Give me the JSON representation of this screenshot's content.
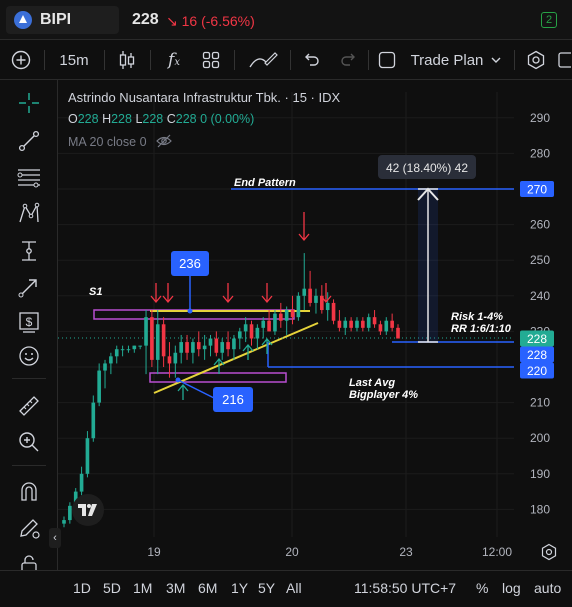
{
  "header": {
    "symbol": "BIPI",
    "price": "228",
    "change": "16 (-6.56%)",
    "alerts_badge": "2"
  },
  "toolbar": {
    "interval": "15m",
    "trade_plan_label": "Trade Plan"
  },
  "legend": {
    "title": "Astrindo Nusantara Infrastruktur Tbk. · 15 · IDX",
    "ohlc": [
      {
        "key": "O",
        "value": "228"
      },
      {
        "key": "H",
        "value": "228"
      },
      {
        "key": "L",
        "value": "228"
      },
      {
        "key": "C",
        "value": "228"
      },
      {
        "key": "",
        "value": "0 (0.00%)"
      }
    ],
    "ma_label": "MA 20 close 0"
  },
  "bottom": {
    "timeframes": [
      "1D",
      "5D",
      "1M",
      "3M",
      "6M",
      "1Y",
      "5Y",
      "All"
    ],
    "clock": "11:58:50 UTC+7",
    "percent": "%",
    "log": "log",
    "auto": "auto"
  },
  "colors": {
    "up": "#22ab94",
    "down": "#f23645",
    "blue": "#2962ff",
    "yellow": "#e6d33a",
    "magenta": "#b84fd1"
  },
  "chart_data": {
    "type": "candlestick",
    "y_axis": {
      "range": [
        173,
        300
      ],
      "ticks": [
        180,
        190,
        200,
        210,
        220,
        230,
        240,
        250,
        260,
        270,
        280,
        290
      ]
    },
    "x_axis": {
      "tick_labels": [
        "19",
        "20",
        "23",
        "12:00"
      ]
    },
    "price_labels": [
      {
        "value": 270,
        "label": "270",
        "color": "#2962ff"
      },
      {
        "value": 228,
        "label": "228",
        "color": "#22ab94"
      },
      {
        "value": 228,
        "label": "228",
        "color": "#2962ff"
      },
      {
        "value": 220,
        "label": "220",
        "color": "#2962ff"
      }
    ],
    "candles": [
      {
        "o": 176,
        "h": 178,
        "l": 175,
        "c": 177
      },
      {
        "o": 177,
        "h": 182,
        "l": 176,
        "c": 181
      },
      {
        "o": 181,
        "h": 186,
        "l": 180,
        "c": 185
      },
      {
        "o": 185,
        "h": 192,
        "l": 184,
        "c": 190
      },
      {
        "o": 190,
        "h": 202,
        "l": 189,
        "c": 200
      },
      {
        "o": 200,
        "h": 212,
        "l": 199,
        "c": 210
      },
      {
        "o": 210,
        "h": 221,
        "l": 209,
        "c": 219
      },
      {
        "o": 219,
        "h": 222,
        "l": 214,
        "c": 221
      },
      {
        "o": 221,
        "h": 224,
        "l": 218,
        "c": 223
      },
      {
        "o": 223,
        "h": 226,
        "l": 221,
        "c": 225
      },
      {
        "o": 225,
        "h": 226,
        "l": 223,
        "c": 225
      },
      {
        "o": 225,
        "h": 226,
        "l": 224,
        "c": 225
      },
      {
        "o": 225,
        "h": 226,
        "l": 224,
        "c": 226
      },
      {
        "o": 226,
        "h": 226,
        "l": 225,
        "c": 226
      },
      {
        "o": 226,
        "h": 236,
        "l": 218,
        "c": 234
      },
      {
        "o": 234,
        "h": 236,
        "l": 220,
        "c": 222
      },
      {
        "o": 222,
        "h": 236,
        "l": 218,
        "c": 232
      },
      {
        "o": 232,
        "h": 234,
        "l": 220,
        "c": 223
      },
      {
        "o": 223,
        "h": 227,
        "l": 217,
        "c": 221
      },
      {
        "o": 221,
        "h": 226,
        "l": 217,
        "c": 224
      },
      {
        "o": 224,
        "h": 229,
        "l": 221,
        "c": 227
      },
      {
        "o": 227,
        "h": 229,
        "l": 222,
        "c": 224
      },
      {
        "o": 224,
        "h": 228,
        "l": 221,
        "c": 227
      },
      {
        "o": 227,
        "h": 230,
        "l": 223,
        "c": 225
      },
      {
        "o": 225,
        "h": 229,
        "l": 222,
        "c": 226
      },
      {
        "o": 226,
        "h": 229,
        "l": 223,
        "c": 228
      },
      {
        "o": 228,
        "h": 230,
        "l": 223,
        "c": 224
      },
      {
        "o": 224,
        "h": 228,
        "l": 222,
        "c": 227
      },
      {
        "o": 227,
        "h": 230,
        "l": 223,
        "c": 225
      },
      {
        "o": 225,
        "h": 229,
        "l": 222,
        "c": 228
      },
      {
        "o": 228,
        "h": 231,
        "l": 225,
        "c": 230
      },
      {
        "o": 230,
        "h": 234,
        "l": 227,
        "c": 232
      },
      {
        "o": 232,
        "h": 233,
        "l": 226,
        "c": 228
      },
      {
        "o": 228,
        "h": 232,
        "l": 225,
        "c": 231
      },
      {
        "o": 231,
        "h": 234,
        "l": 228,
        "c": 233
      },
      {
        "o": 233,
        "h": 236,
        "l": 230,
        "c": 230
      },
      {
        "o": 230,
        "h": 236,
        "l": 229,
        "c": 235
      },
      {
        "o": 235,
        "h": 238,
        "l": 231,
        "c": 233
      },
      {
        "o": 233,
        "h": 237,
        "l": 229,
        "c": 236
      },
      {
        "o": 236,
        "h": 240,
        "l": 232,
        "c": 234
      },
      {
        "o": 234,
        "h": 241,
        "l": 233,
        "c": 240
      },
      {
        "o": 240,
        "h": 252,
        "l": 236,
        "c": 242
      },
      {
        "o": 242,
        "h": 247,
        "l": 237,
        "c": 238
      },
      {
        "o": 238,
        "h": 242,
        "l": 235,
        "c": 240
      },
      {
        "o": 240,
        "h": 243,
        "l": 235,
        "c": 236
      },
      {
        "o": 236,
        "h": 241,
        "l": 233,
        "c": 238
      },
      {
        "o": 238,
        "h": 239,
        "l": 232,
        "c": 233
      },
      {
        "o": 233,
        "h": 236,
        "l": 230,
        "c": 231
      },
      {
        "o": 231,
        "h": 234,
        "l": 229,
        "c": 233
      },
      {
        "o": 233,
        "h": 234,
        "l": 230,
        "c": 231
      },
      {
        "o": 231,
        "h": 234,
        "l": 230,
        "c": 233
      },
      {
        "o": 233,
        "h": 234,
        "l": 230,
        "c": 231
      },
      {
        "o": 231,
        "h": 235,
        "l": 230,
        "c": 234
      },
      {
        "o": 234,
        "h": 236,
        "l": 231,
        "c": 232
      },
      {
        "o": 232,
        "h": 233,
        "l": 229,
        "c": 230
      },
      {
        "o": 230,
        "h": 234,
        "l": 229,
        "c": 233
      },
      {
        "o": 233,
        "h": 235,
        "l": 230,
        "c": 231
      },
      {
        "o": 231,
        "h": 232,
        "l": 228,
        "c": 228
      }
    ],
    "annotations": {
      "end_pattern": "End Pattern",
      "s1": "S1",
      "label_236": "236",
      "label_216": "216",
      "measure": "42 (18.40%) 42",
      "risk": "Risk 1-4%",
      "rr": "RR 1:6/1:10",
      "last_avg": "Last Avg",
      "bigplayer": "Bigplayer 4%"
    },
    "levels": {
      "target": 270,
      "entry": 228,
      "support": 220,
      "resistance_band": [
        234,
        236
      ],
      "support_band": [
        217,
        219
      ]
    }
  }
}
